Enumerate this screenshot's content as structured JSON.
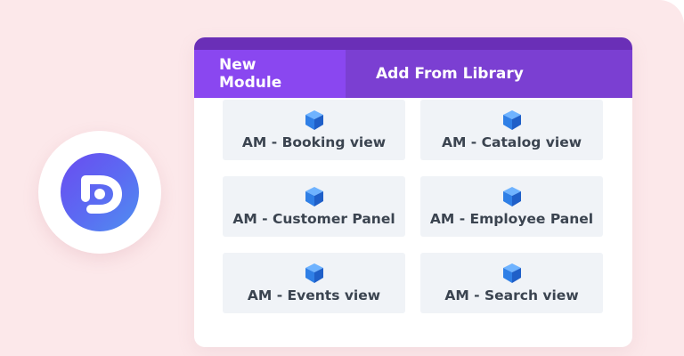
{
  "tabs": [
    {
      "label": "New Module",
      "active": true
    },
    {
      "label": "Add From Library",
      "active": false
    }
  ],
  "modules": [
    {
      "label": "AM - Booking view",
      "icon": "amelia-cube-icon"
    },
    {
      "label": "AM - Catalog view",
      "icon": "amelia-cube-icon"
    },
    {
      "label": "AM - Customer Panel",
      "icon": "amelia-cube-icon"
    },
    {
      "label": "AM - Employee Panel",
      "icon": "amelia-cube-icon"
    },
    {
      "label": "AM - Events view",
      "icon": "amelia-cube-icon"
    },
    {
      "label": "AM - Search view",
      "icon": "amelia-cube-icon"
    }
  ],
  "logo": {
    "icon": "divi-logo-icon"
  },
  "colors": {
    "background": "#fce8ea",
    "tab_bar": "#7b3fd2",
    "tab_active": "#8a47f0",
    "module_bg": "#f0f3f7",
    "icon_blue": "#3d8ef0"
  }
}
